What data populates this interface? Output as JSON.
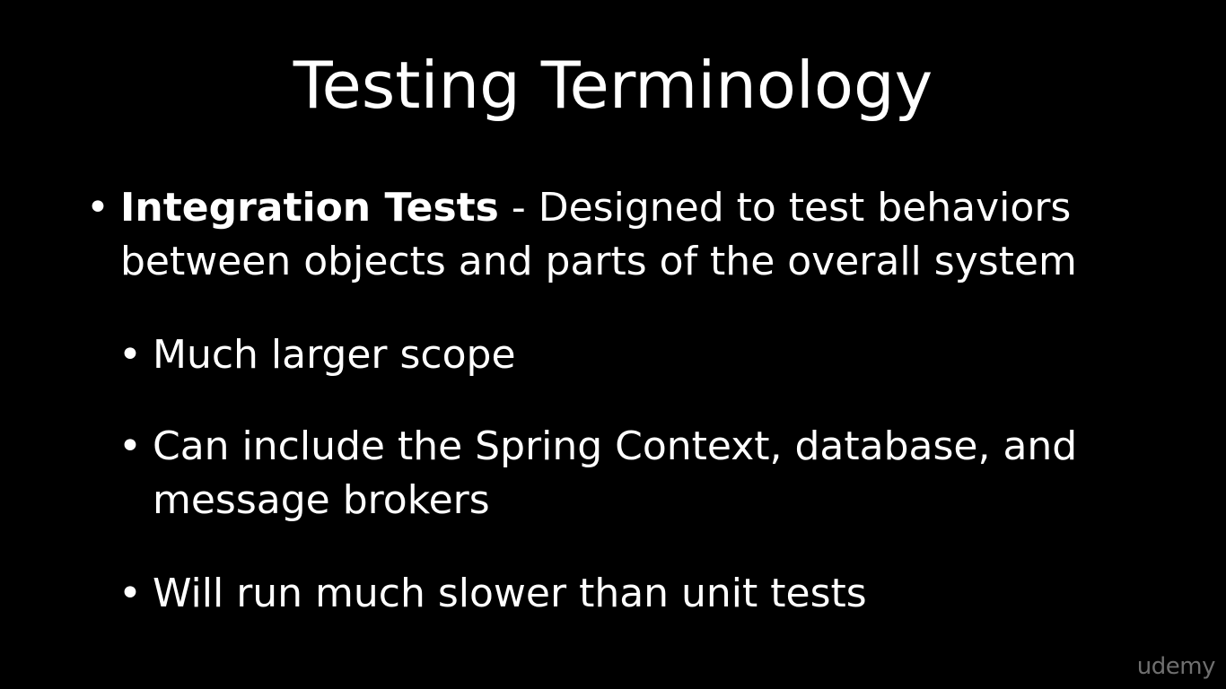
{
  "slide": {
    "title": "Testing Terminology",
    "main_bullet": {
      "term": "Integration Tests",
      "separator": " - ",
      "line1_rest": "Designed to test behaviors",
      "line2": "between objects and parts of the overall system"
    },
    "sub_bullets": [
      {
        "line1": "Much larger scope"
      },
      {
        "line1": "Can include the Spring Context, database, and",
        "line2": "message brokers"
      },
      {
        "line1": "Will run much slower than unit tests"
      }
    ],
    "bullet_glyph": "•",
    "watermark": "udemy"
  }
}
